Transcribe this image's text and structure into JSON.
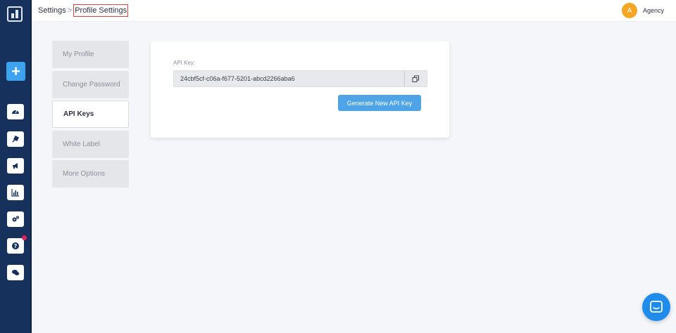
{
  "breadcrumb": {
    "root": "Settings",
    "separator": ">",
    "current": "Profile Settings"
  },
  "user": {
    "initial": "A",
    "name": "Agency"
  },
  "sidebar": {
    "icons": [
      "logo-icon",
      "add-icon",
      "dashboard-icon",
      "plug-icon",
      "megaphone-icon",
      "chart-icon",
      "cogs-icon",
      "help-icon",
      "chat-icon"
    ]
  },
  "tabs": [
    {
      "label": "My Profile",
      "active": false
    },
    {
      "label": "Change Password",
      "active": false
    },
    {
      "label": "API Keys",
      "active": true
    },
    {
      "label": "White Label",
      "active": false
    },
    {
      "label": "More Options",
      "active": false
    }
  ],
  "api": {
    "label": "API Key:",
    "key": "24cbf5cf-c06a-f677-5201-abcd2266aba6",
    "generate_label": "Generate New API Key"
  },
  "colors": {
    "sidebar": "#16325c",
    "accent": "#4fa4e8",
    "avatar": "#f5a623",
    "highlight": "#e0443a"
  }
}
